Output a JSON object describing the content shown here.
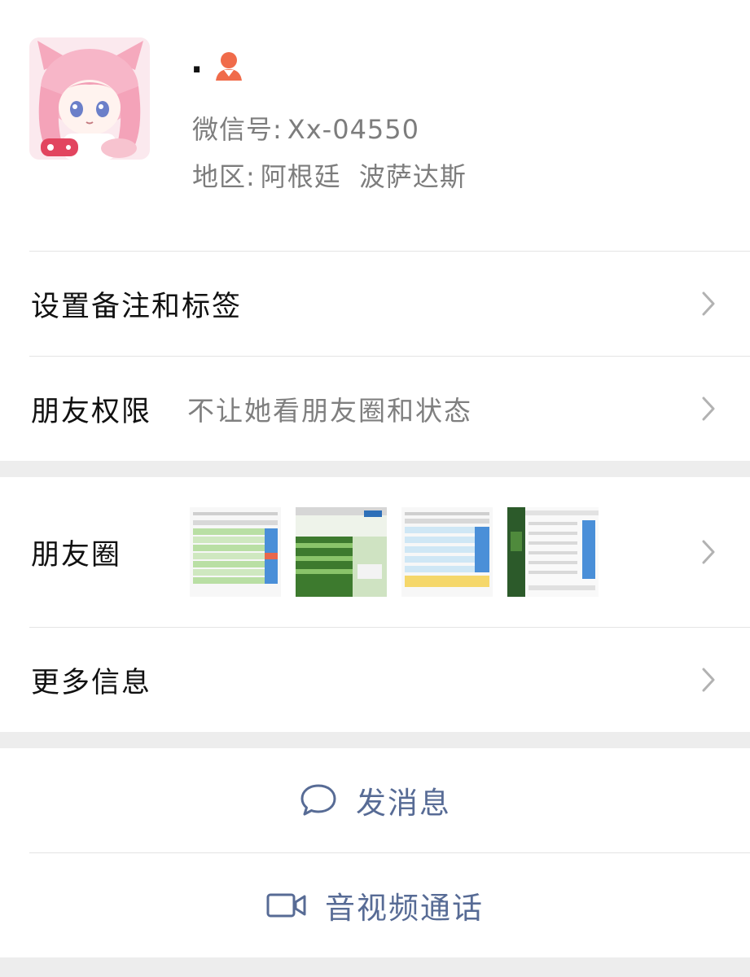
{
  "profile": {
    "nickname": ".",
    "wechat_id_label": "微信号:",
    "wechat_id": "Xx-04550",
    "region_label": "地区:",
    "region_country": "阿根廷",
    "region_city": "波萨达斯",
    "gender_icon": "female-user-icon",
    "gender_color": "#f06b4a"
  },
  "menu": {
    "remark_label": "设置备注和标签",
    "permissions_label": "朋友权限",
    "permissions_value": "不让她看朋友圈和状态",
    "moments_label": "朋友圈",
    "more_label": "更多信息"
  },
  "actions": {
    "message_label": "发消息",
    "call_label": "音视频通话",
    "link_color": "#576b95"
  }
}
